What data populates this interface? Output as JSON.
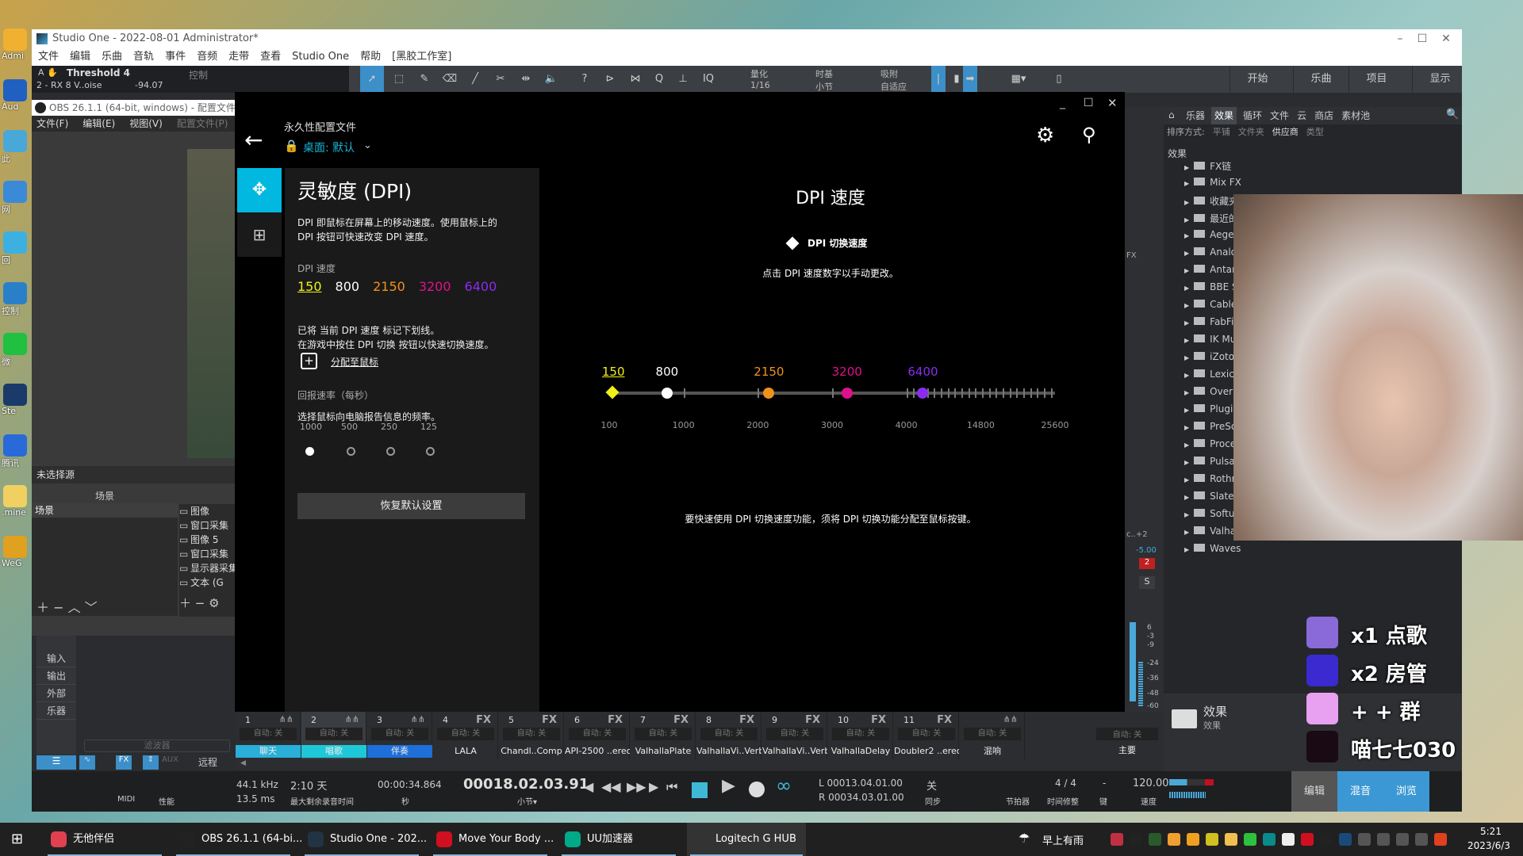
{
  "desktop": {
    "icons": [
      "Admi",
      "Aud",
      "此",
      "网",
      "回",
      "控制",
      "微",
      "Ste",
      "腾讯",
      ".mine",
      "WeG"
    ]
  },
  "studio_one": {
    "title": "Studio One - 2022-08-01 Administrator*",
    "menu": [
      "文件",
      "编辑",
      "乐曲",
      "音轨",
      "事件",
      "音频",
      "走带",
      "查看",
      "Studio One",
      "帮助",
      "[黑胶工作室]"
    ],
    "toolbar": {
      "plugin": "Threshold 4",
      "track": "2 - RX 8 V..oise",
      "value": "-94.07",
      "control": "控制",
      "quantize_label": "量化",
      "quantize": "1/16",
      "timebase_label": "时基",
      "timebase": "小节",
      "snap_label": "吸附",
      "snap": "自适应",
      "pages": [
        "开始",
        "乐曲",
        "项目",
        "显示"
      ]
    },
    "nav": [
      "输入",
      "输出",
      "外部",
      "乐器"
    ],
    "filter_placeholder": "滤波器",
    "bottom_tabs": [
      "FX",
      "AUX",
      "远程"
    ],
    "browser": {
      "tabs": [
        "乐器",
        "效果",
        "循环",
        "文件",
        "云",
        "商店",
        "素材池"
      ],
      "active_tab": "效果",
      "sort_label": "排序方式:",
      "sort_options": [
        "平铺",
        "文件夹",
        "供应商",
        "类型"
      ],
      "active_sort": "供应商",
      "breadcrumb": "效果",
      "items": [
        "FX链",
        "Mix FX",
        "收藏夹",
        "最近的",
        "Aegean",
        "Analog",
        "Antares",
        "BBE S",
        "Cable",
        "FabFil",
        "IK Mu",
        "iZotop",
        "Lexico",
        "Overlo",
        "Plugin",
        "PreSo",
        "Proce",
        "Pulsar",
        "Rothm",
        "Slate",
        "Softub",
        "Valhal",
        "Waves"
      ],
      "folder_title": "效果",
      "folder_sub": "效果"
    },
    "side_strip": {
      "fx": "FX",
      "pan": "c..+2",
      "gain": "-5.00",
      "num": "2",
      "solo": "S",
      "meter_ticks": [
        "6",
        "-3",
        "-9",
        "-24",
        "-36",
        "-48",
        "-60"
      ],
      "auto": "自动: 关",
      "name": "主要"
    },
    "mixer": {
      "auto": "自动: 关",
      "channels": [
        {
          "num": "1",
          "label": "聊天",
          "color": "#2ab0d8"
        },
        {
          "num": "2",
          "label": "唱歌",
          "color": "#1fc8d8"
        },
        {
          "num": "3",
          "label": "伴奏",
          "color": "#1e6fd8"
        },
        {
          "num": "4",
          "fx": "FX",
          "label": "LALA"
        },
        {
          "num": "5",
          "fx": "FX",
          "label": "Chandl..Comp"
        },
        {
          "num": "6",
          "fx": "FX",
          "label": "API-2500 ..ereo"
        },
        {
          "num": "7",
          "fx": "FX",
          "label": "ValhallaPlate"
        },
        {
          "num": "8",
          "fx": "FX",
          "label": "ValhallaVi..Verb"
        },
        {
          "num": "9",
          "fx": "FX",
          "label": "ValhallaVi..Verb"
        },
        {
          "num": "10",
          "fx": "FX",
          "label": "ValhallaDelay"
        },
        {
          "num": "11",
          "fx": "FX",
          "label": "Doubler2 ..ereo"
        },
        {
          "num": "",
          "label": "混响"
        }
      ]
    },
    "transport": {
      "midi": "MIDI",
      "perf": "性能",
      "rate": "44.1 kHz",
      "latency": "13.5 ms",
      "rec_time": "2:10 天",
      "rec_label": "最大剩余录音时间",
      "seconds": "00:00:34.864",
      "seconds_label": "秒",
      "bars": "00018.02.03.91",
      "bars_label": "小节▾",
      "loop_l": "00013.04.01.00",
      "loop_r": "00034.03.01.00",
      "sync": "关",
      "sync_label": "同步",
      "metronome": "节拍器",
      "signature": "4 / 4",
      "signature_label": "时间修整",
      "key": "-",
      "key_label": "键",
      "tempo": "120.00",
      "tempo_label": "速度",
      "views": [
        "编辑",
        "混音",
        "浏览"
      ],
      "active_view": "混音"
    }
  },
  "obs": {
    "title": "OBS 26.1.1 (64-bit, windows) - 配置文件:",
    "menu": [
      "文件(F)",
      "编辑(E)",
      "视图(V)",
      "配置文件(P)"
    ],
    "no_source": "未选择源",
    "scenes_header": "场景",
    "scenes": [
      "场景"
    ],
    "sources": [
      "图像",
      "窗口采集",
      "图像 5",
      "窗口采集",
      "显示器采集",
      "文本 (G"
    ]
  },
  "ghub": {
    "profile_label": "永久性配置文件",
    "profile": "桌面: 默认",
    "panel": {
      "title": "灵敏度 (DPI)",
      "desc1": "DPI 即鼠标在屏幕上的移动速度。使用鼠标上的",
      "desc2": "DPI 按钮可快速改变 DPI 速度。",
      "dpi_label": "DPI 速度",
      "note1": "已将 当前 DPI 速度 标记下划线。",
      "note2": "在游戏中按住 DPI 切换 按钮以快速切换速度。",
      "assign": "分配至鼠标",
      "rate_label": "回报速率（每秒）",
      "rate_desc": "选择鼠标向电脑报告信息的频率。",
      "rates": [
        "1000",
        "500",
        "250",
        "125"
      ],
      "selected_rate": "1000",
      "reset": "恢复默认设置"
    },
    "main": {
      "title": "DPI 速度",
      "legend": "DPI 切换速度",
      "hint": "点击 DPI 速度数字以手动更改。",
      "footer": "要快速使用 DPI 切换速度功能，须将 DPI 切换功能分配至鼠标按键。"
    },
    "dpi_levels": [
      {
        "value": "150",
        "color": "#f0f018",
        "current": true,
        "shift": true
      },
      {
        "value": "800",
        "color": "#ffffff"
      },
      {
        "value": "2150",
        "color": "#f0921a"
      },
      {
        "value": "3200",
        "color": "#e0108a"
      },
      {
        "value": "6400",
        "color": "#8a2cf0"
      }
    ],
    "scale": [
      "100",
      "1000",
      "2000",
      "3000",
      "4000",
      "14800",
      "25600"
    ]
  },
  "overlay": {
    "lines": [
      "x1 点歌",
      "x2 房管",
      "+ + 群",
      "喵七七030"
    ]
  },
  "taskbar": {
    "items": [
      {
        "label": "无他伴侣",
        "color": "#e04050"
      },
      {
        "label": "OBS 26.1.1 (64-bi...",
        "color": "#222"
      },
      {
        "label": "Studio One - 202...",
        "color": "#234"
      },
      {
        "label": "Move Your Body ...",
        "color": "#d01020"
      },
      {
        "label": "UU加速器",
        "color": "#0a8"
      },
      {
        "label": "Logitech G HUB",
        "color": "#333"
      }
    ],
    "weather": "早上有雨",
    "time": "5:21",
    "date": "2023/6/3"
  }
}
